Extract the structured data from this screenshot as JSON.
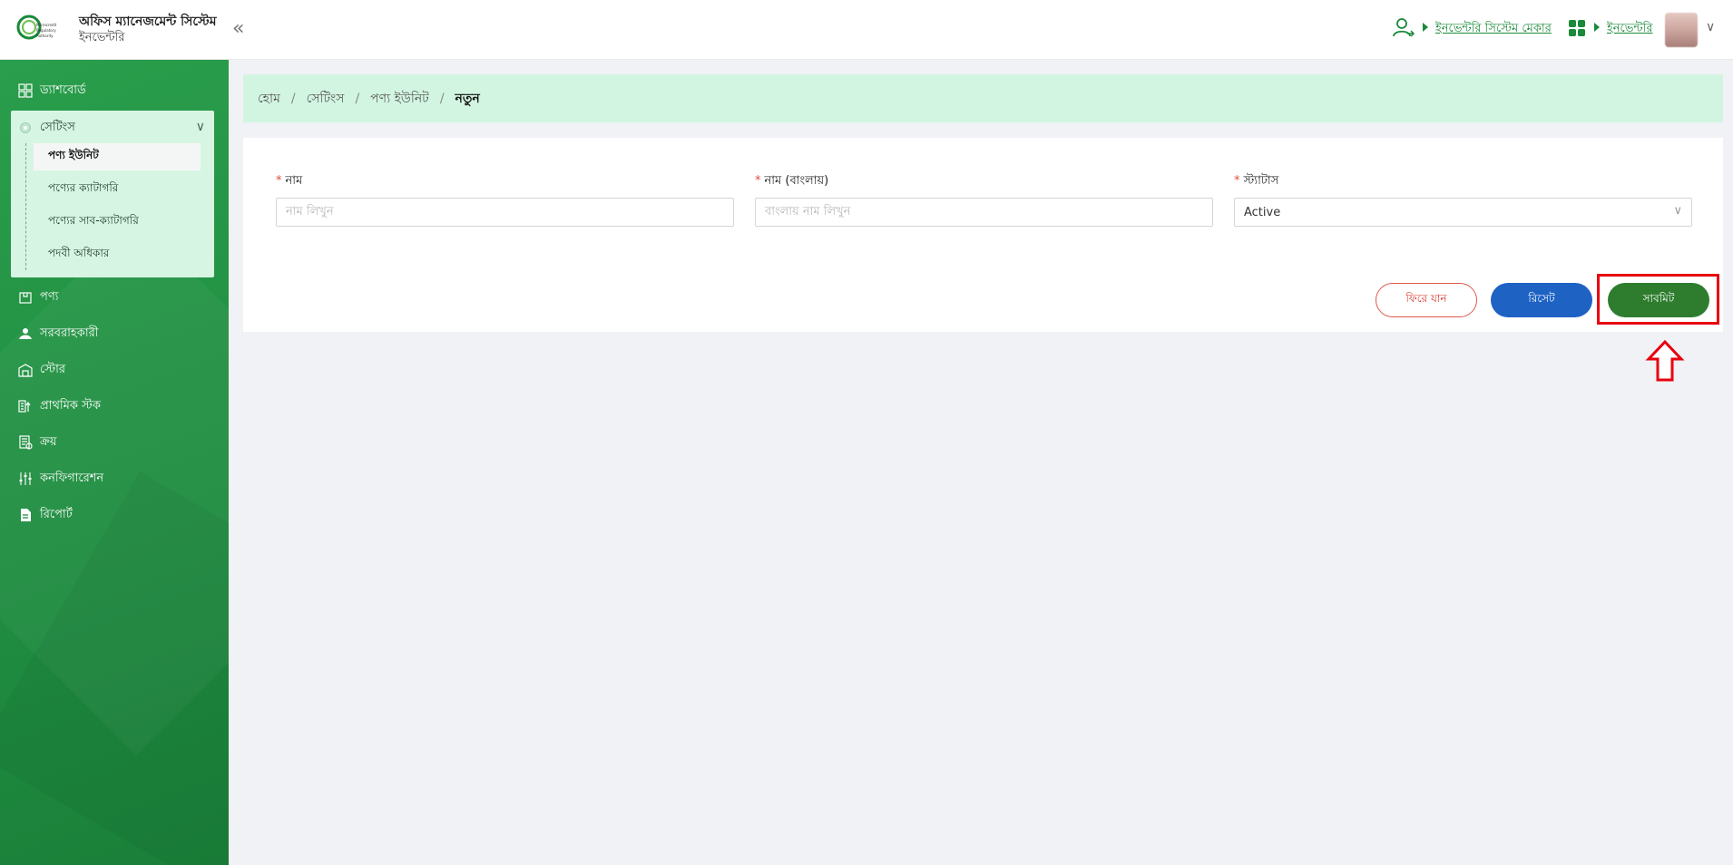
{
  "header": {
    "app_title": "অফিস ম্যানেজমেন্ট সিস্টেম",
    "app_subtitle": "ইনভেন্টরি",
    "collapse_symbol": "«",
    "user_role_link": "ইনভেন্টরি সিস্টেম মেকার",
    "module_link": "ইনভেন্টরি",
    "logo_text": "Microcredit Regulatory Authority"
  },
  "sidebar": {
    "items": [
      {
        "label": "ড্যাশবোর্ড",
        "icon": "dashboard-icon"
      },
      {
        "label": "পণ্য",
        "icon": "product-icon"
      },
      {
        "label": "সরবরাহকারী",
        "icon": "supplier-icon"
      },
      {
        "label": "স্টোর",
        "icon": "store-icon"
      },
      {
        "label": "প্রাথমিক স্টক",
        "icon": "stock-icon"
      },
      {
        "label": "ক্রয়",
        "icon": "purchase-icon"
      },
      {
        "label": "কনফিগারেশন",
        "icon": "configuration-icon"
      },
      {
        "label": "রিপোর্ট",
        "icon": "report-icon"
      }
    ],
    "settings": {
      "label": "সেটিংস",
      "sub_items": [
        {
          "label": "পণ্য ইউনিট"
        },
        {
          "label": "পণ্যের ক্যাটাগরি"
        },
        {
          "label": "পণ্যের সাব-ক্যাটাগরি"
        },
        {
          "label": "পদবী অধিকার"
        }
      ]
    }
  },
  "breadcrumb": {
    "items": [
      "হোম",
      "সেটিংস",
      "পণ্য ইউনিট",
      "নতুন"
    ],
    "separator": "/"
  },
  "form": {
    "name_label": "নাম",
    "name_placeholder": "নাম লিখুন",
    "name_bn_label": "নাম (বাংলায়)",
    "name_bn_placeholder": "বাংলায় নাম লিখুন",
    "status_label": "স্ট্যাটাস",
    "status_value": "Active",
    "required_mark": "*"
  },
  "buttons": {
    "back": "ফিরে যান",
    "reset": "রিসেট",
    "submit": "সাবমিট"
  },
  "colors": {
    "brand_green": "#1a8a3a",
    "highlight_red": "#e8000f",
    "reset_blue": "#1e62c4",
    "submit_green": "#2e7d2e"
  }
}
